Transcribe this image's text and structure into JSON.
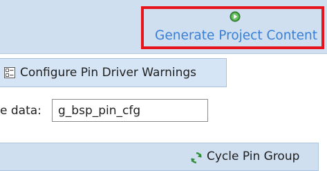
{
  "toolbar": {
    "generate_label": "Generate Project Content",
    "generate_icon": "run-icon"
  },
  "tab": {
    "configure_label": "Configure Pin Driver Warnings",
    "configure_icon": "list-settings-icon"
  },
  "pin_data": {
    "label": "e data:",
    "value": "g_bsp_pin_cfg"
  },
  "footer": {
    "cycle_label": "Cycle Pin Group",
    "cycle_icon": "cycle-icon"
  },
  "colors": {
    "highlight_border": "#e8141b",
    "link_blue": "#3a7fd6",
    "panel_bg": "#cfdff0"
  }
}
